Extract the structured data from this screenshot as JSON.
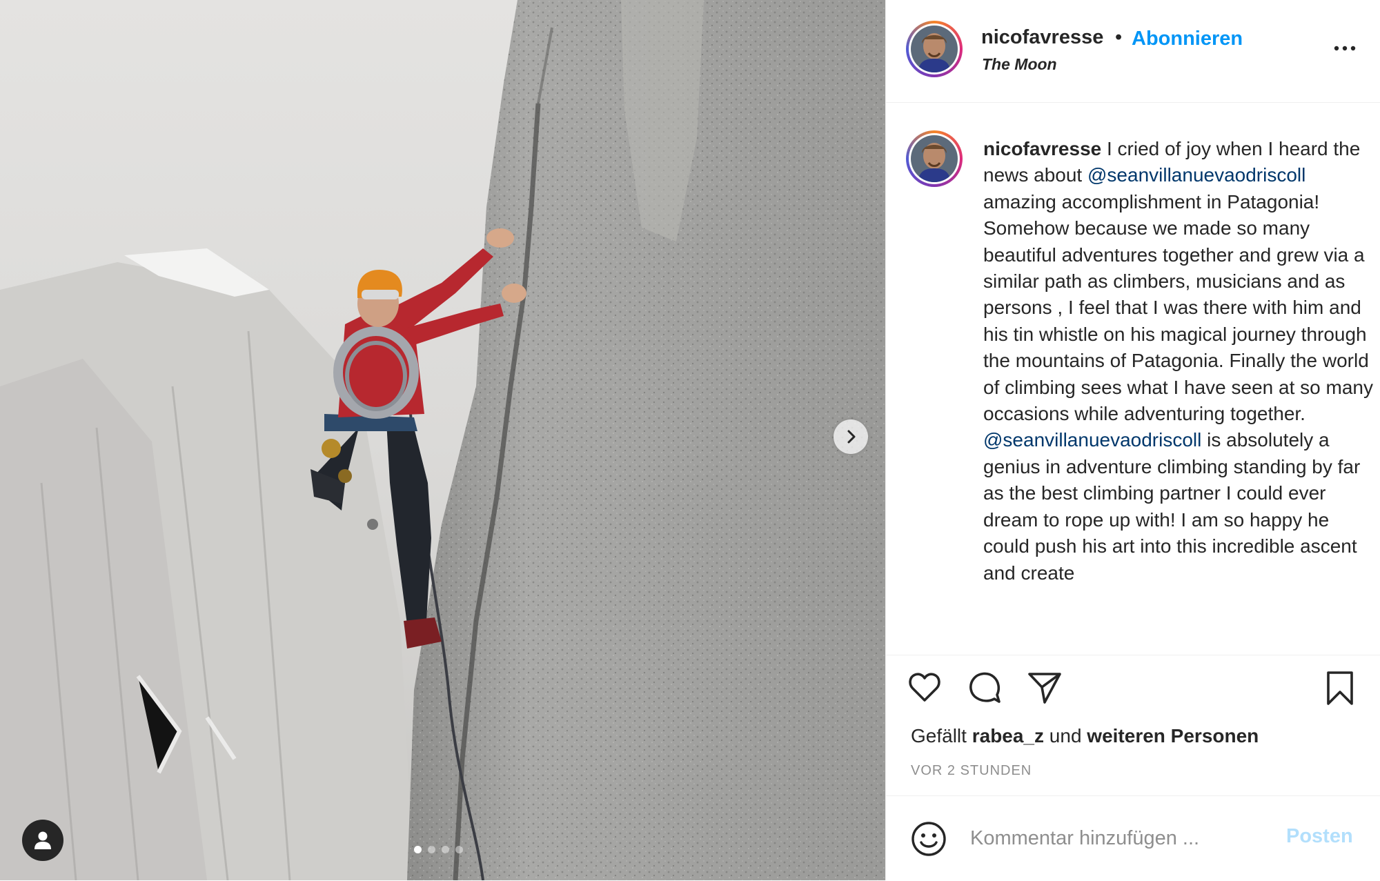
{
  "post": {
    "username": "nicofavresse",
    "separator": "•",
    "follow_label": "Abonnieren",
    "location": "The Moon",
    "more_icon": "more-horizontal-icon"
  },
  "carousel": {
    "slide_count": 4,
    "active_index": 0
  },
  "caption": {
    "username": "nicofavresse",
    "segments": [
      {
        "text": "I cried of joy when I heard the news about ",
        "mention": false
      },
      {
        "text": "@seanvillanuevaodriscoll",
        "mention": true
      },
      {
        "text": " amazing accomplishment in Patagonia! Somehow because we made so many beautiful adventures together and grew via a similar path as climbers, musicians and as persons , I feel that I was there with him and his tin whistle on his magical journey through the mountains of Patagonia. Finally the world of climbing sees what I have seen at so many occasions while adventuring together. ",
        "mention": false
      },
      {
        "text": "@seanvillanuevaodriscoll",
        "mention": true
      },
      {
        "text": " is absolutely a genius in adventure climbing standing by far as the best climbing partner I could ever dream to rope up with! I am so happy he could push his art into this incredible ascent and create",
        "mention": false
      }
    ]
  },
  "likes": {
    "prefix": "Gefällt",
    "user": "rabea_z",
    "middle": "und",
    "suffix": "weiteren Personen"
  },
  "timestamp": "VOR 2 STUNDEN",
  "comment": {
    "placeholder": "Kommentar hinzufügen ...",
    "post_label": "Posten"
  },
  "colors": {
    "accent": "#0095f6",
    "mention": "#00376b",
    "post_disabled": "#b2dffc",
    "muted": "#8e8e8e"
  }
}
